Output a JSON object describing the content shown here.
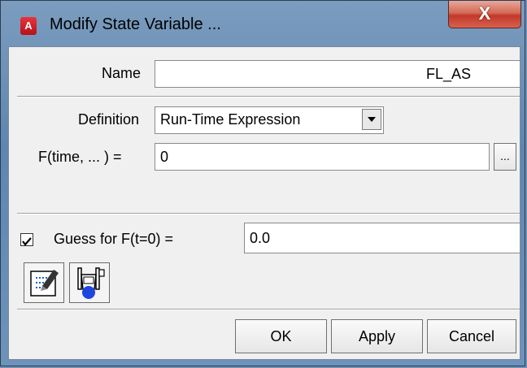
{
  "window": {
    "title": "Modify State Variable ...",
    "app_icon_letter": "A",
    "close_glyph": "X"
  },
  "form": {
    "name_label": "Name",
    "name_value": "FL_AS",
    "definition_label": "Definition",
    "definition_value": "Run-Time Expression",
    "function_label": "F(time, ... ) =",
    "function_value": "0",
    "ellipsis_label": "...",
    "guess_checked": true,
    "guess_label": "Guess for F(t=0) =",
    "guess_value": "0.0"
  },
  "tools": [
    {
      "icon": "notes-edit-icon"
    },
    {
      "icon": "measure-instrument-icon"
    }
  ],
  "buttons": {
    "ok": "OK",
    "apply": "Apply",
    "cancel": "Cancel"
  },
  "colors": {
    "title_gradient_top": "#7b9cbe",
    "close_red": "#c2382a",
    "app_icon_red": "#d42029"
  }
}
